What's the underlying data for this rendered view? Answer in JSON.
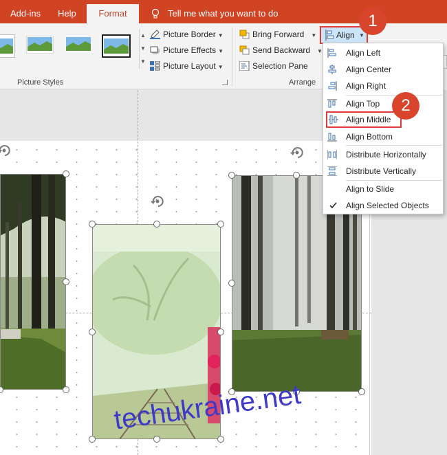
{
  "tabs": [
    {
      "label": "Add-ins"
    },
    {
      "label": "Help"
    },
    {
      "label": "Format",
      "active": true
    }
  ],
  "tell_me": "Tell me what you want to do",
  "picture_styles": {
    "group_label": "Picture Styles",
    "picture_border": "Picture Border",
    "picture_effects": "Picture Effects",
    "picture_layout": "Picture Layout"
  },
  "arrange": {
    "group_label": "Arrange",
    "bring_forward": "Bring Forward",
    "send_backward": "Send Backward",
    "selection_pane": "Selection Pane",
    "align": "Align"
  },
  "callouts": [
    "1",
    "2"
  ],
  "align_menu": {
    "items": [
      {
        "label": "Align Left",
        "icon": "align-left-icon"
      },
      {
        "label": "Align Center",
        "icon": "align-center-icon"
      },
      {
        "label": "Align Right",
        "icon": "align-right-icon"
      },
      {
        "label": "Align Top",
        "icon": "align-top-icon"
      },
      {
        "label": "Align Middle",
        "icon": "align-middle-icon",
        "highlighted": true
      },
      {
        "label": "Align Bottom",
        "icon": "align-bottom-icon"
      },
      {
        "label": "Distribute Horizontally",
        "icon": "distribute-horizontal-icon"
      },
      {
        "label": "Distribute Vertically",
        "icon": "distribute-vertical-icon"
      },
      {
        "label": "Align to Slide",
        "icon": ""
      },
      {
        "label": "Align Selected Objects",
        "icon": "checkmark-icon",
        "checked": true
      }
    ]
  },
  "watermark": "techukraine.net",
  "colors": {
    "tab_bar": "#d04424",
    "highlight": "#e03b3b",
    "badge": "#d9452c",
    "watermark": "#3e3ac7"
  }
}
